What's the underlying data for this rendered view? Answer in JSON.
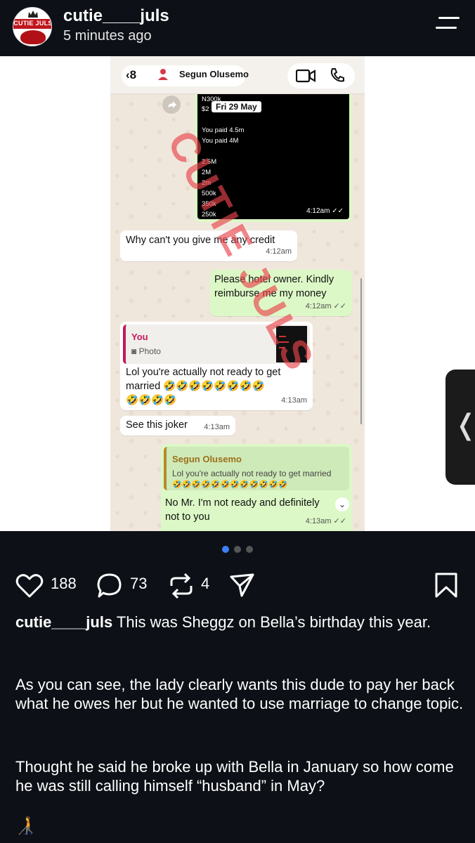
{
  "header": {
    "username": "cutie____juls",
    "timestamp": "5 minutes ago",
    "avatar_text": "CUTIE JULS"
  },
  "chat": {
    "back_count": "8",
    "contact_name": "Segun Olusemo",
    "image_lines": [
      "N300k",
      "$2",
      "You paid 4.5m",
      "You paid 4M",
      "2.5M",
      "2M",
      "2m",
      "500k",
      "350k",
      "250k"
    ],
    "date_pill": "Fri 29 May",
    "image_time": "4:12am",
    "msg1": {
      "text": "Why can't you give me any credit",
      "time": "4:12am"
    },
    "msg2": {
      "text_line1": "Please hotel owner. Kindly",
      "text_line2": "reimburse me my money",
      "time": "4:12am"
    },
    "msg3": {
      "quote_author": "You",
      "quote_type": "Photo",
      "text_line1": "Lol you're actually not ready to get",
      "text_line2": "married 🤣🤣🤣🤣🤣🤣🤣🤣",
      "text_line3": "🤣🤣🤣🤣",
      "time": "4:13am"
    },
    "msg4": {
      "text": "See this joker",
      "time": "4:13am"
    },
    "msg5": {
      "quote_author": "Segun Olusemo",
      "quote_text": "Lol you're actually not ready to get married",
      "quote_emojis": "🤣🤣🤣🤣🤣🤣🤣🤣🤣🤣🤣🤣",
      "text_line1": "No Mr. I'm not ready and definitely",
      "text_line2": "not to you",
      "time": "4:13am"
    },
    "watermark_text": "CUTIE JULS"
  },
  "actions": {
    "likes": "188",
    "comments": "73",
    "reposts": "4"
  },
  "caption": {
    "author": "cutie____juls",
    "para1": "This was Sheggz on Bella’s birthday this year.",
    "para2": "As you can see, the lady clearly wants this dude to pay her back what he owes her but he wanted to use marriage to change topic.",
    "para3": "Thought he said he broke up with Bella in January so how come he was still calling himself “husband” in May?",
    "emoji": "🧑‍🦯"
  },
  "colors": {
    "background": "#0d1117",
    "bubble_out": "#dcf8c6",
    "bubble_in": "#ffffff",
    "watermark": "#e8434b"
  },
  "pagination": {
    "total": 3,
    "active": 1
  }
}
